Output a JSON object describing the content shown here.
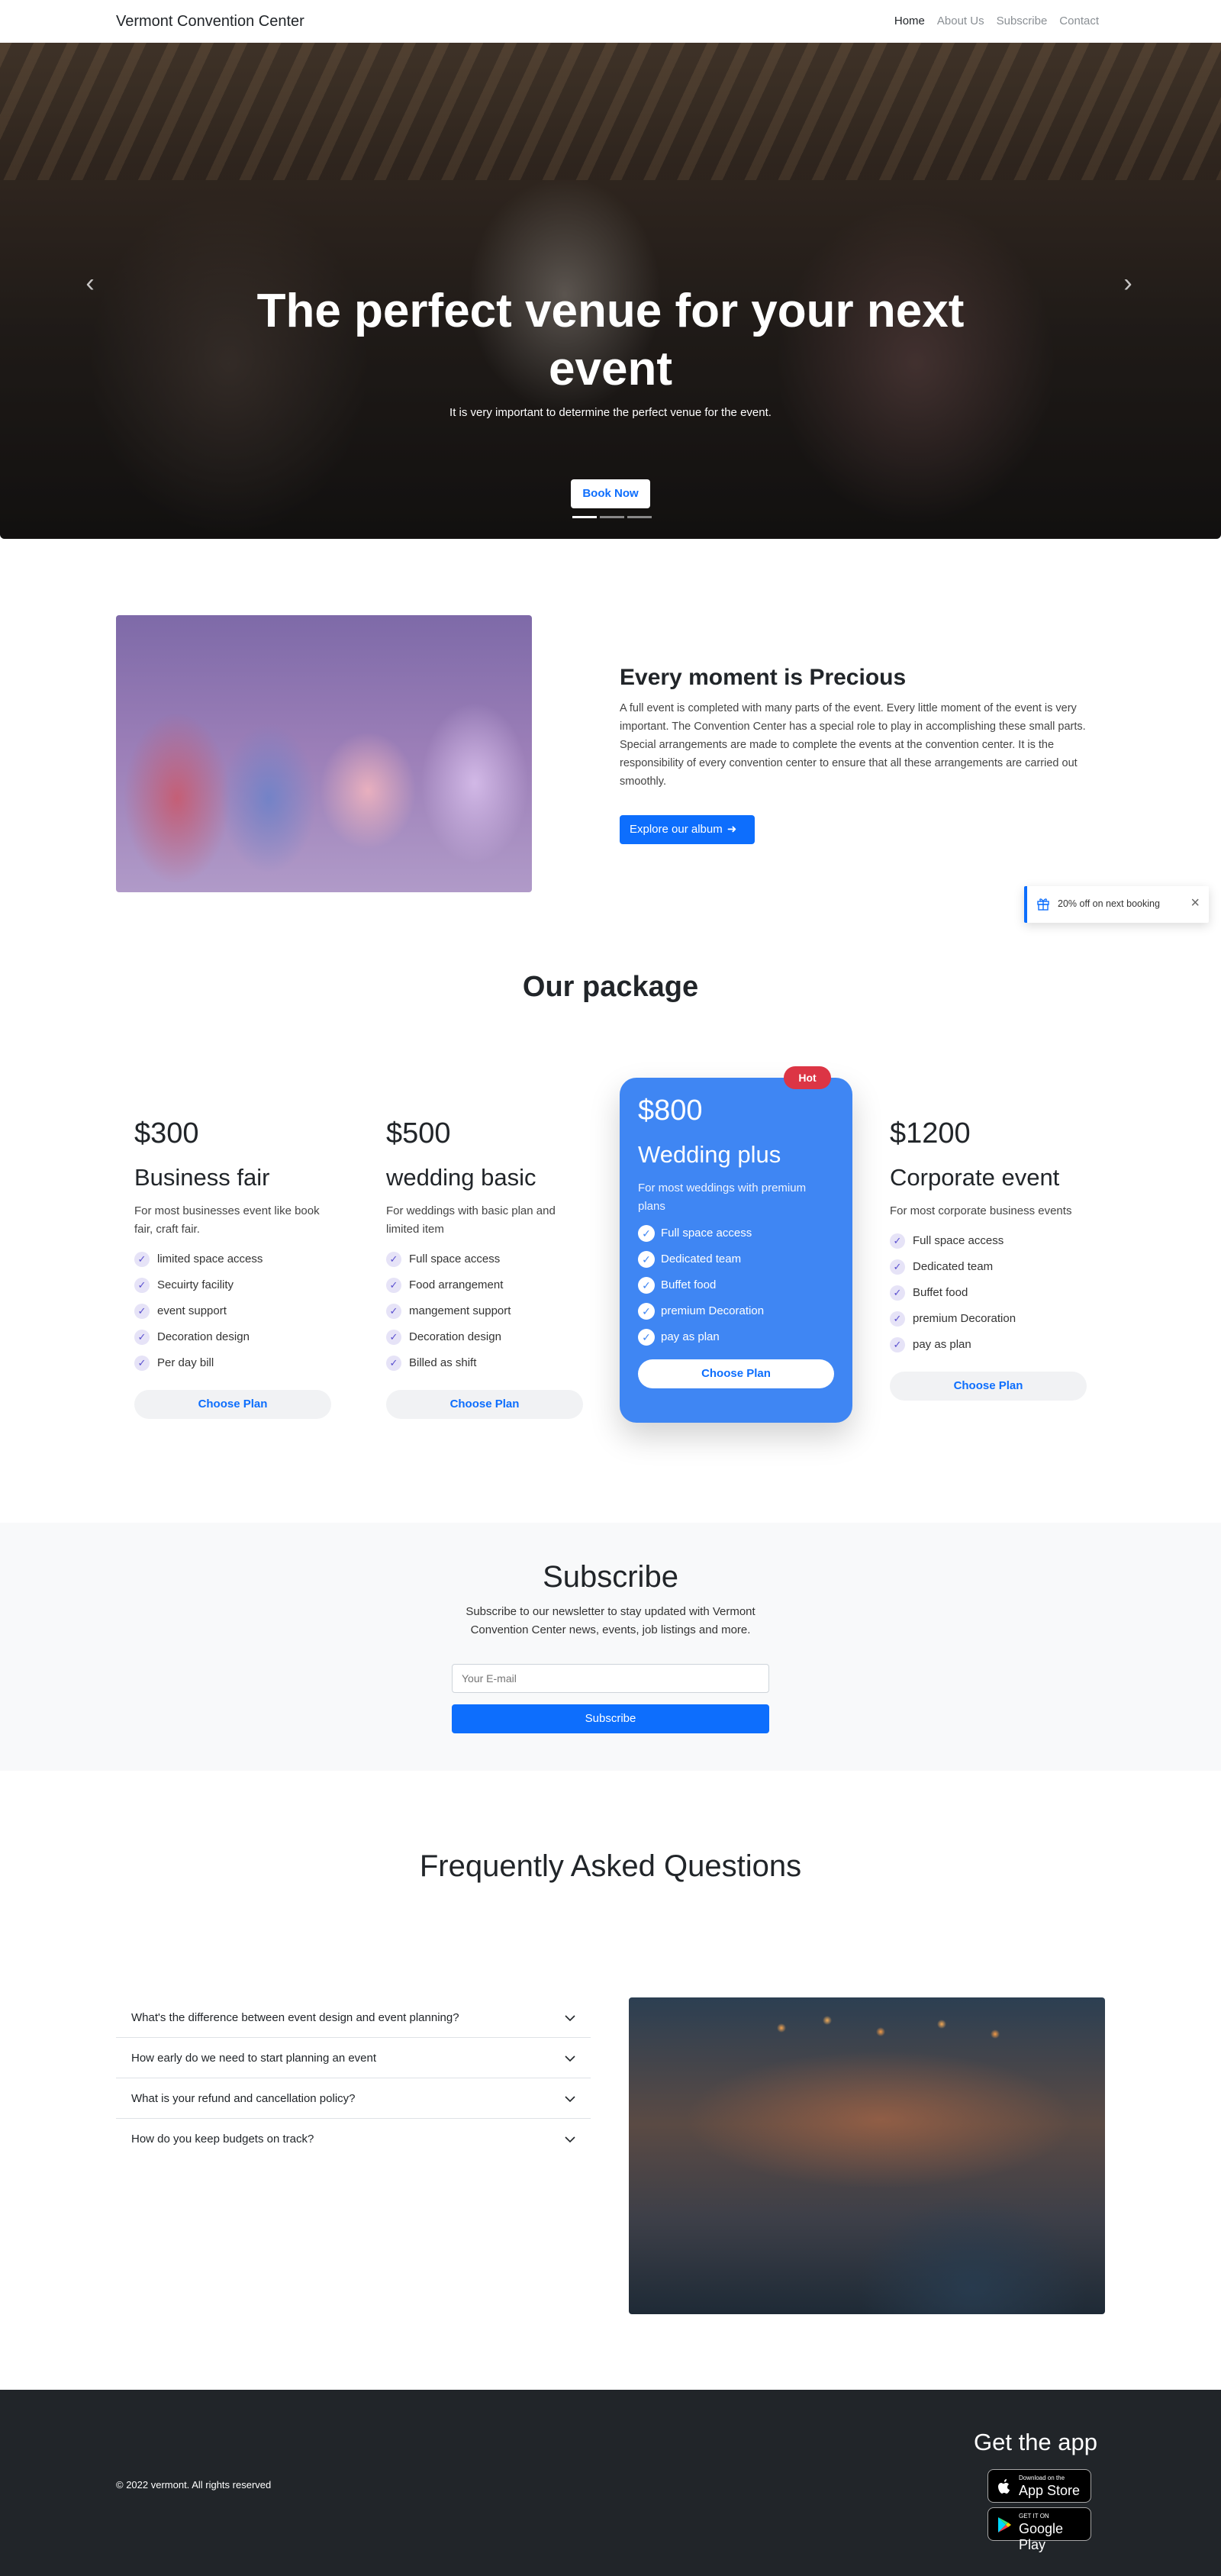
{
  "nav": {
    "brand": "Vermont Convention Center",
    "links": [
      "Home",
      "About Us",
      "Subscribe",
      "Contact"
    ]
  },
  "hero": {
    "title": "The perfect venue for your next event",
    "subtitle": "It is very important to determine the perfect venue for the event.",
    "button": "Book Now",
    "prev_icon": "chevron-left-icon",
    "next_icon": "chevron-right-icon",
    "slides": 3,
    "active_slide": 1
  },
  "about": {
    "title": "Every moment is Precious",
    "text": "A full event is completed with many parts of the event. Every little moment of the event is very important. The Convention Center has a special role to play in accomplishing these small parts. Special arrangements are made to complete the events at the convention center. It is the responsibility of every convention center to ensure that all these arrangements are carried out smoothly.",
    "button": "Explore our album"
  },
  "toast": {
    "message": "20% off on next booking",
    "icon": "gift-icon"
  },
  "packages": {
    "title": "Our package",
    "cards": [
      {
        "price": "$300",
        "name": "Business fair",
        "desc": "For most businesses event like book fair, craft fair.",
        "features": [
          "limited space access",
          "Secuirty facility",
          "event support",
          "Decoration design",
          "Per day bill"
        ],
        "button": "Choose Plan"
      },
      {
        "price": "$500",
        "name": "wedding basic",
        "desc": "For weddings with basic plan and limited item",
        "features": [
          "Full space access",
          "Food arrangement",
          "mangement support",
          "Decoration design",
          "Billed as shift"
        ],
        "button": "Choose Plan"
      },
      {
        "price": "$800",
        "name": "Wedding plus",
        "desc": "For most weddings with premium plans",
        "features": [
          "Full space access",
          "Dedicated team",
          "Buffet food",
          "premium Decoration",
          "pay as plan"
        ],
        "button": "Choose Plan",
        "badge": "Hot"
      },
      {
        "price": "$1200",
        "name": "Corporate event",
        "desc": "For most corporate business events",
        "features": [
          "Full space access",
          "Dedicated team",
          "Buffet food",
          "premium Decoration",
          "pay as plan"
        ],
        "button": "Choose Plan"
      }
    ]
  },
  "subscribe": {
    "title": "Subscribe",
    "text": "Subscribe to our newsletter to stay updated with Vermont Convention Center news, events, job listings and more.",
    "placeholder": "Your E-mail",
    "button": "Subscribe"
  },
  "faq": {
    "title": "Frequently Asked Questions",
    "items": [
      "What's the difference between event design and event planning?",
      "How early do we need to start planning an event",
      "What is your refund and cancellation policy?",
      "How do you keep budgets on track?"
    ]
  },
  "footer": {
    "copyright": "© 2022 vermont. All rights reserved",
    "app_title": "Get the app",
    "app_store": {
      "small": "Download on the",
      "big": "App Store"
    },
    "google_play": {
      "small": "GET IT ON",
      "big": "Google Play"
    }
  },
  "colors": {
    "primary": "#0d6efd",
    "hot_card": "#3f86f3",
    "badge": "#dc3545",
    "footer": "#212529"
  }
}
